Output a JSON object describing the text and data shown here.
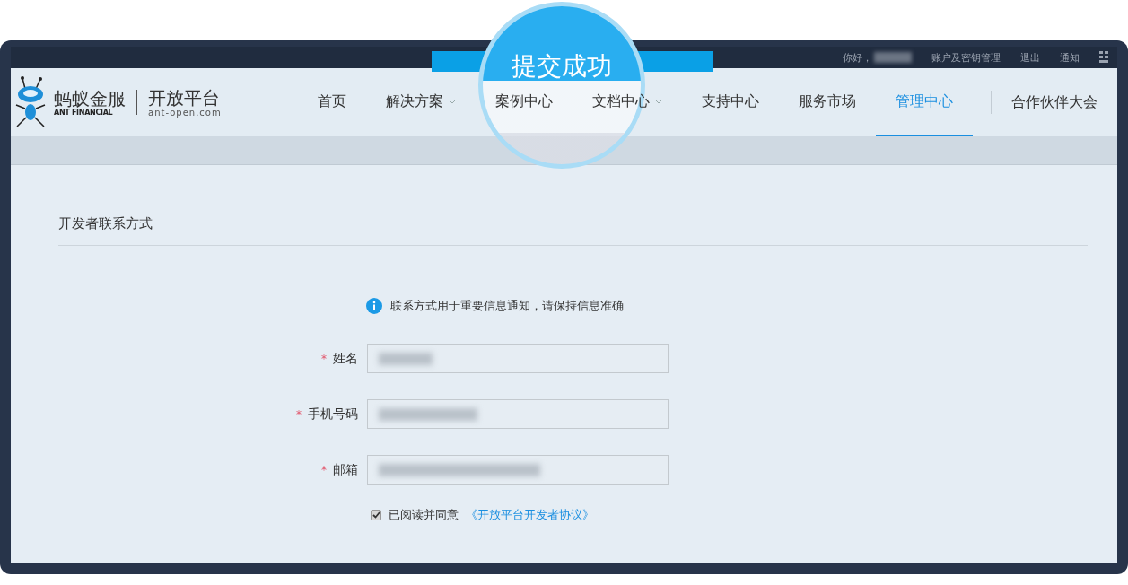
{
  "badge": {
    "text": "提交成功"
  },
  "top_bar": {
    "greeting": "你好，",
    "links": [
      "账户及密钥管理",
      "退出",
      "通知"
    ]
  },
  "logo": {
    "brand": "蚂蚁金服",
    "brand_en": "ANT FINANCIAL",
    "platform": "开放平台",
    "domain": "ant-open.com"
  },
  "nav": [
    {
      "label": "首页",
      "selected": false,
      "dropdown": false
    },
    {
      "label": "解决方案",
      "selected": false,
      "dropdown": true
    },
    {
      "label": "案例中心",
      "selected": false,
      "dropdown": false
    },
    {
      "label": "文档中心",
      "selected": false,
      "dropdown": true
    },
    {
      "label": "支持中心",
      "selected": false,
      "dropdown": false
    },
    {
      "label": "服务市场",
      "selected": false,
      "dropdown": false
    },
    {
      "label": "管理中心",
      "selected": true,
      "dropdown": false
    }
  ],
  "nav_extra": "合作伙伴大会",
  "section": {
    "title": "开发者联系方式"
  },
  "notice": "联系方式用于重要信息通知，请保持信息准确",
  "fields": [
    {
      "label": "姓名",
      "marker": "*"
    },
    {
      "label": "手机号码",
      "marker": "*"
    },
    {
      "label": "邮箱",
      "marker": "*"
    }
  ],
  "agreement": {
    "checked": true,
    "text": "已阅读并同意",
    "link": "《开放平台开发者协议》"
  }
}
